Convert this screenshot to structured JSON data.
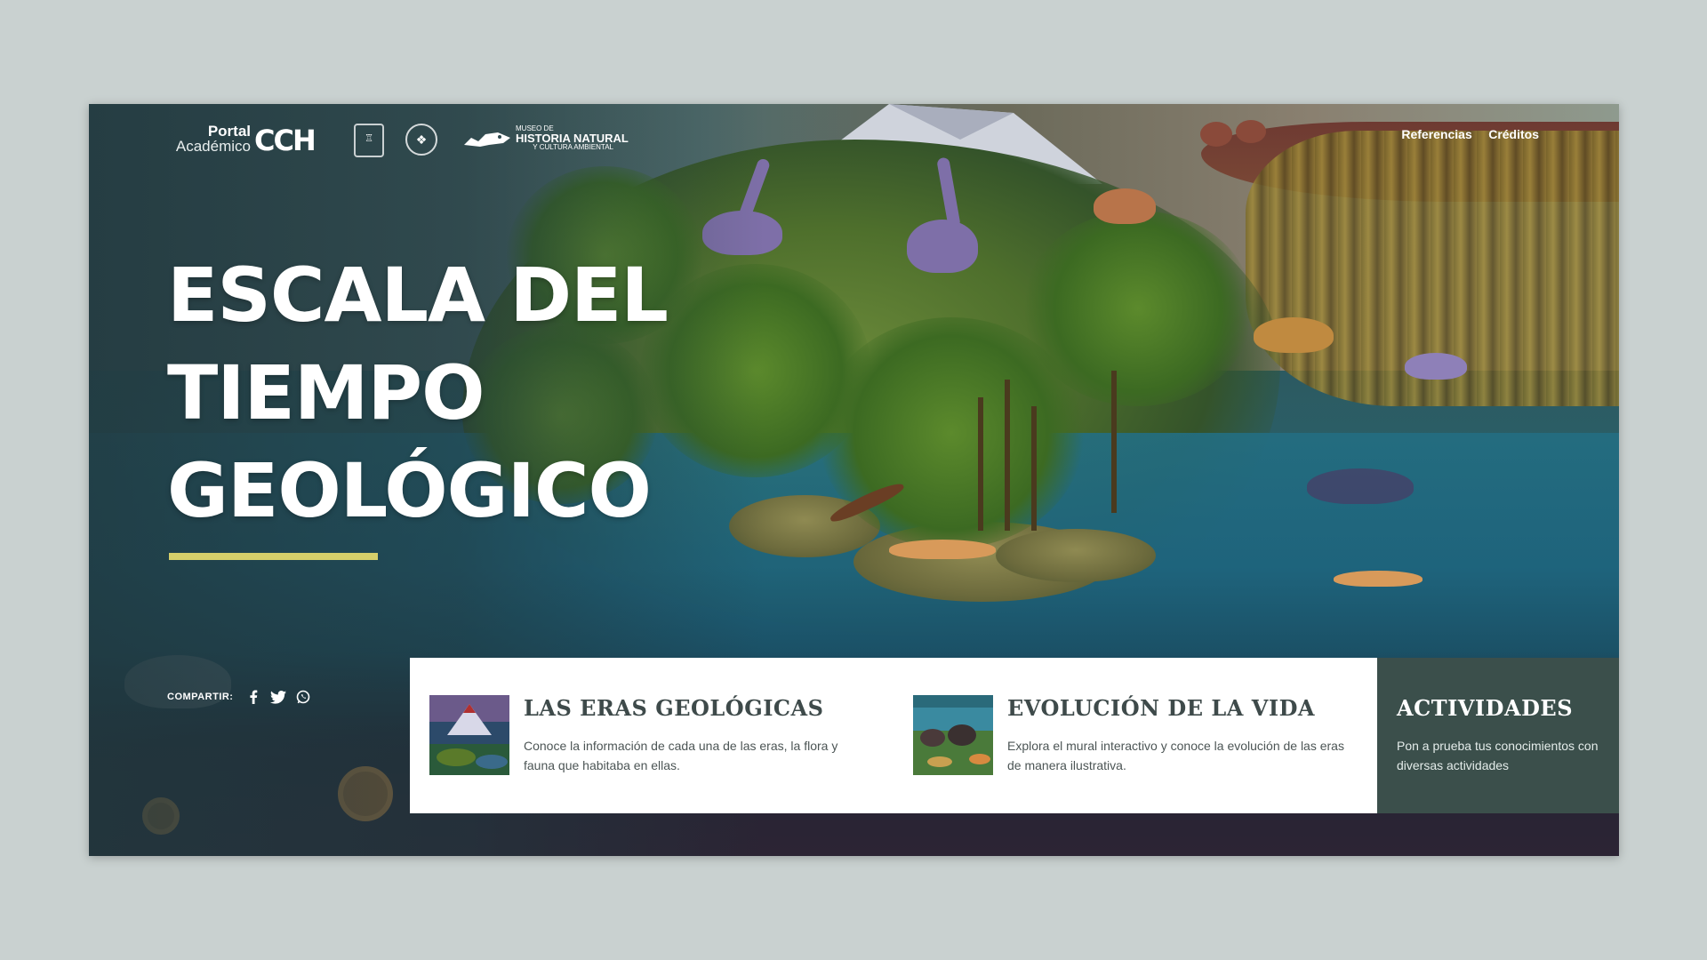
{
  "header": {
    "logo_portal_line1": "Portal",
    "logo_portal_line2": "Académico",
    "logo_cch": "CCH",
    "museo_line1": "MUSEO DE",
    "museo_line2": "HISTORIA NATURAL",
    "museo_line3": "Y CULTURA AMBIENTAL",
    "nav": [
      {
        "label": "Referencias"
      },
      {
        "label": "Créditos"
      }
    ]
  },
  "hero": {
    "title_lines": [
      "ESCALA DEL",
      "TIEMPO",
      "GEOLÓGICO"
    ],
    "rule_color": "#d6cf6a"
  },
  "share": {
    "label": "COMPARTIR:",
    "icons": [
      "facebook-icon",
      "twitter-icon",
      "whatsapp-icon"
    ]
  },
  "cards": [
    {
      "title": "LAS ERAS GEOLÓGICAS",
      "description": "Conoce la información de cada una de las eras, la flora y fauna que habitaba en ellas."
    },
    {
      "title": "EVOLUCIÓN DE LA VIDA",
      "description": "Explora el mural interactivo y conoce la evolución de las eras de manera ilustrativa."
    },
    {
      "title": "ACTIVIDADES",
      "description": "Pon a prueba tus conocimientos con diversas actividades"
    }
  ],
  "colors": {
    "page_background": "#c9d1d0",
    "activities_background": "#3b4f4b",
    "card_title": "#3e4a4a",
    "accent_rule": "#d6cf6a"
  }
}
